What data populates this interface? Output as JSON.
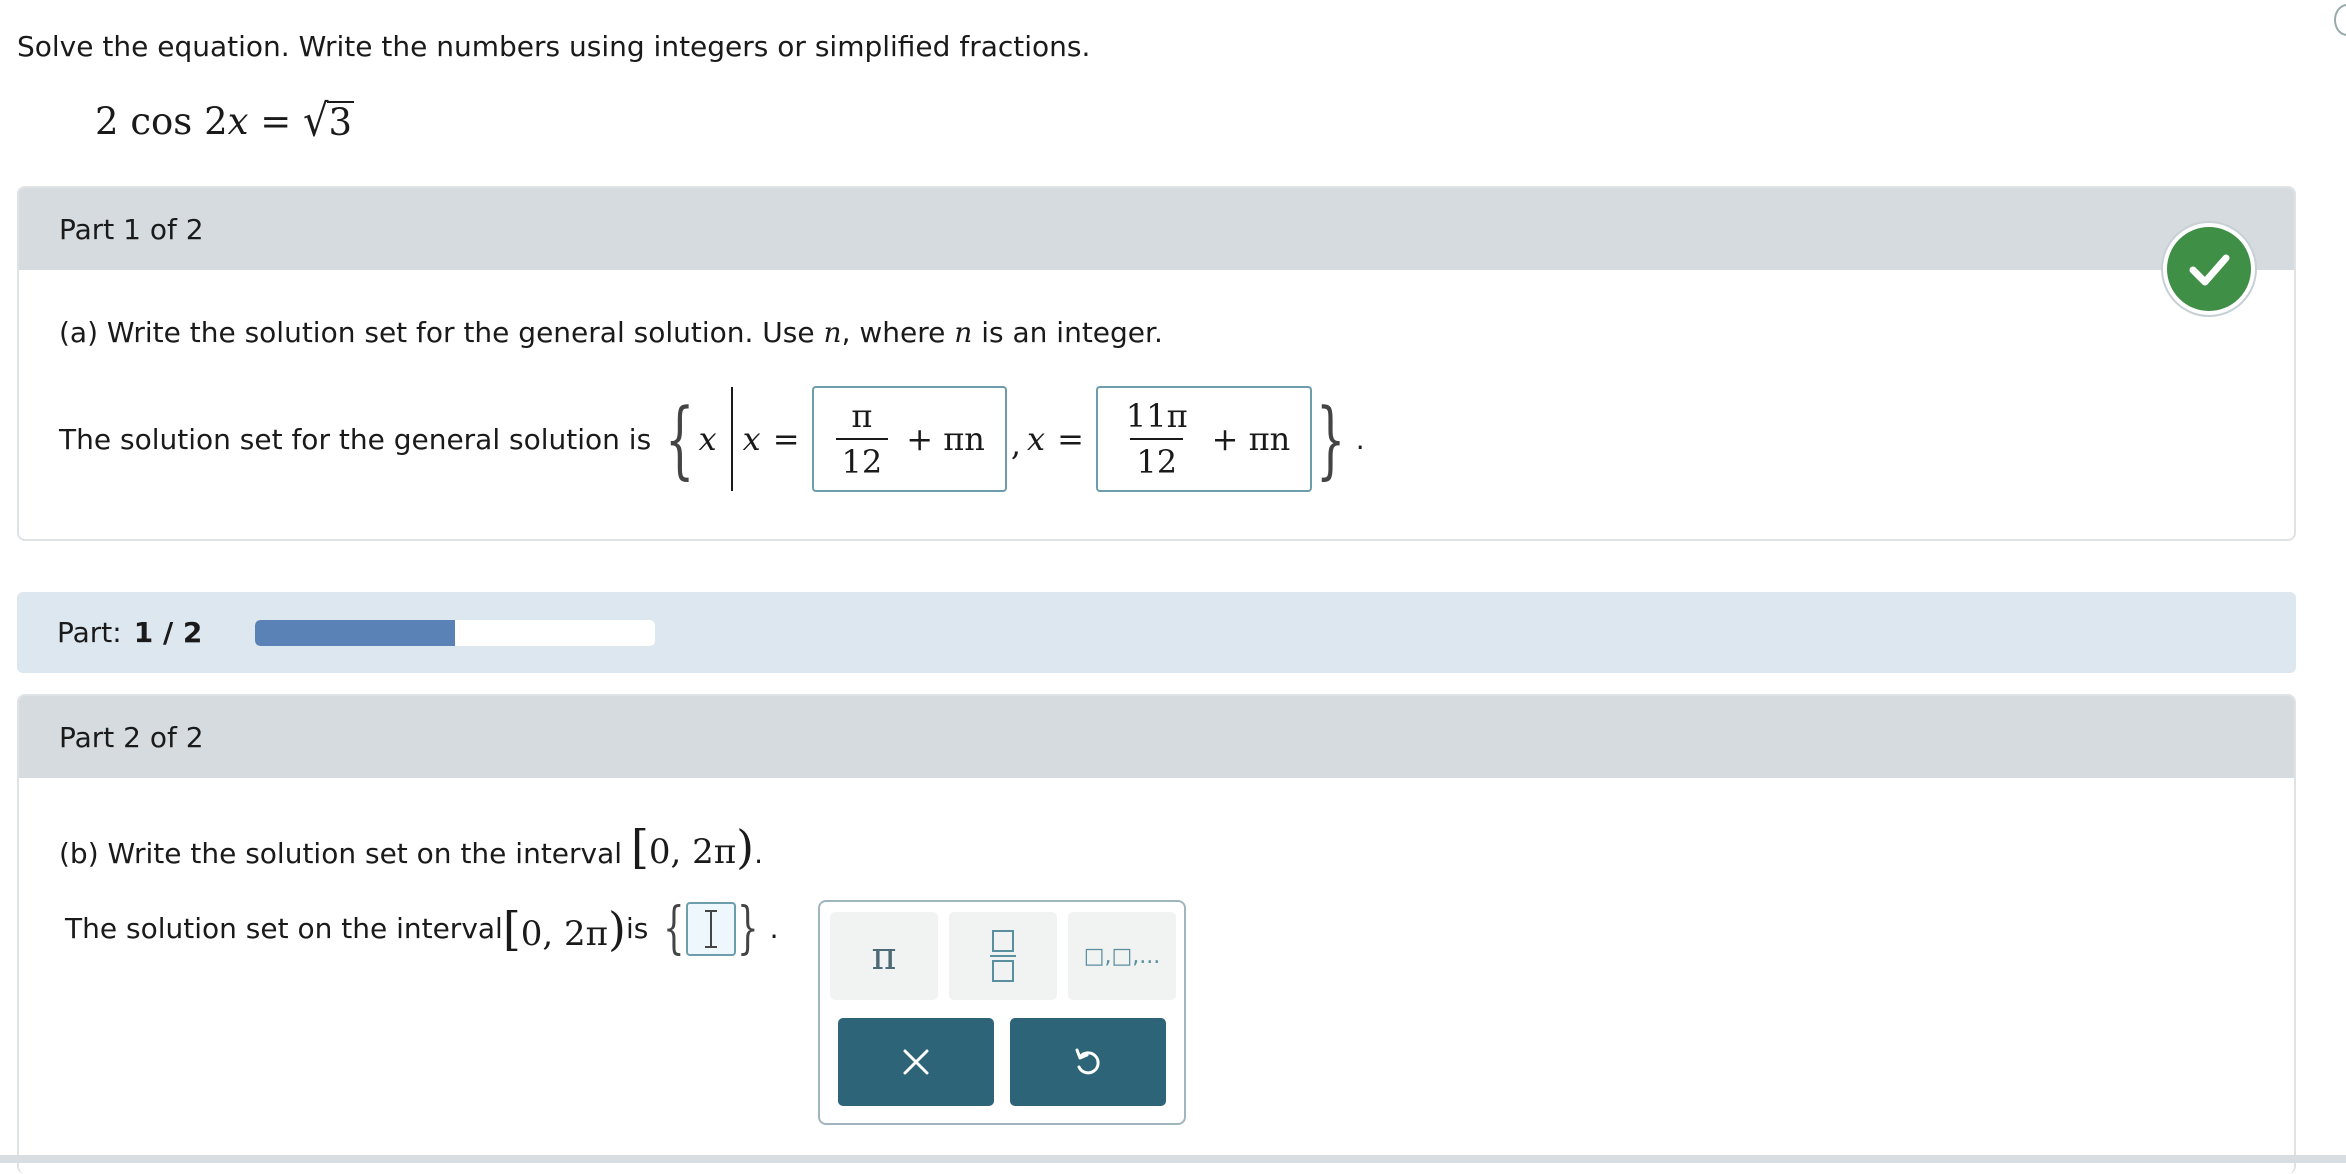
{
  "instructions": "Solve the equation. Write the numbers using integers or simplified fractions.",
  "equation": {
    "coef": "2",
    "func": "cos",
    "arg_coef": "2",
    "var": "x",
    "eq": "=",
    "radicand": "3"
  },
  "part1": {
    "header": "Part 1 of 2",
    "question_lead": "(a) Write the solution set for the general solution. Use ",
    "question_var1": "n",
    "question_mid": ", where ",
    "question_var2": "n",
    "question_tail": " is an integer.",
    "answer_label": "The solution set for the general solution is",
    "set_var": "x",
    "x_label": "x",
    "eq": "=",
    "ans1": {
      "num": "π",
      "den": "12",
      "tail": "+ πn"
    },
    "comma": ",",
    "x_label2": "x",
    "eq2": "=",
    "ans2": {
      "num": "11π",
      "den": "12",
      "tail": "+ πn"
    },
    "period": "."
  },
  "progress": {
    "label": "Part:",
    "value": "1 / 2",
    "fraction": 0.5
  },
  "part2": {
    "header": "Part 2 of 2",
    "question_lead": "(b) Write the solution set on the interval ",
    "interval_text": "0, 2π",
    "question_tail": ".",
    "answer_lead": "The solution set on the interval ",
    "answer_mid": " is",
    "answer_tail": "."
  },
  "keypad": {
    "pi_key": "π",
    "fraction_key": "fraction-icon",
    "list_key": "□,□,...",
    "clear_key": "close-icon",
    "undo_key": "undo-icon"
  },
  "colors": {
    "check": "#3f8f47",
    "progress_fill": "#5a82b7",
    "action_button": "#2e6478",
    "answer_border": "#6d9dab"
  }
}
